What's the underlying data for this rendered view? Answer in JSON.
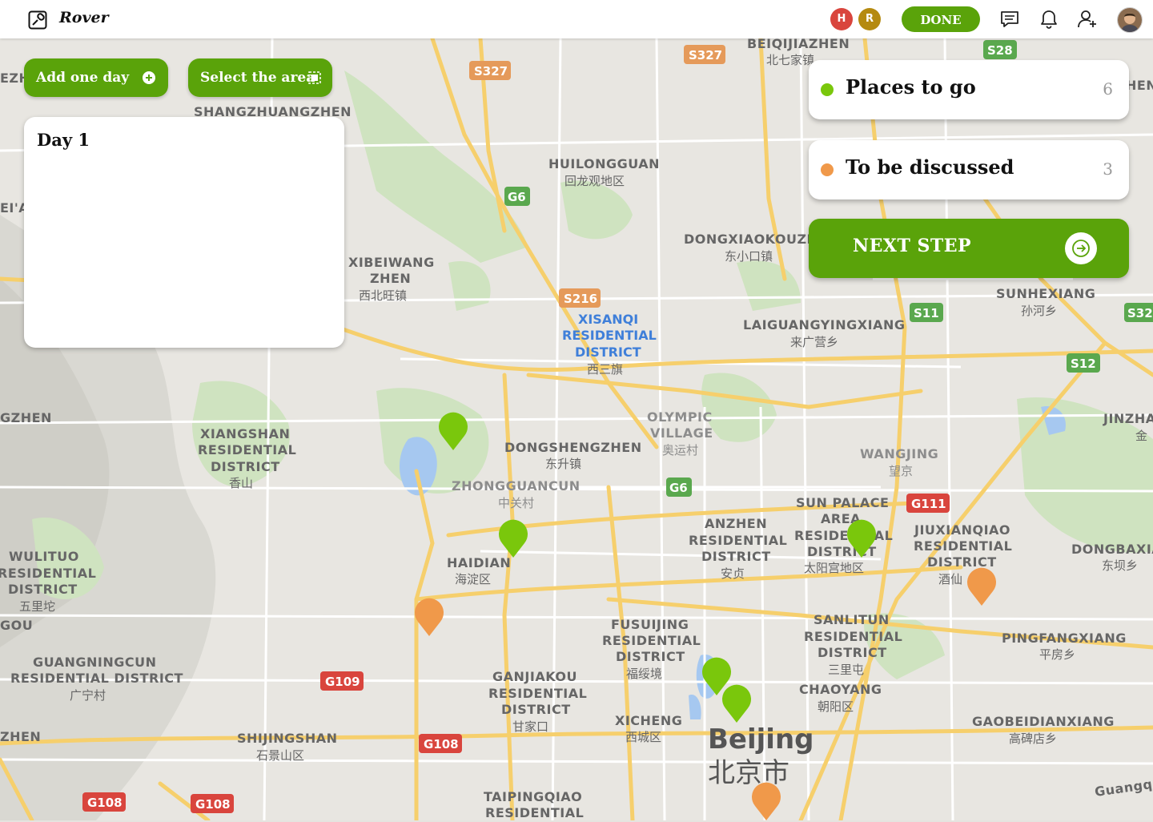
{
  "app": {
    "name": "Rover",
    "done_label": "DONE",
    "collaborators": [
      {
        "initial": "H",
        "color": "#d9453d"
      },
      {
        "initial": "R",
        "color": "#b58a10"
      }
    ],
    "accent": "#5aa30a",
    "icons": [
      "chat-icon",
      "bell-icon",
      "add-user-icon"
    ]
  },
  "controls": {
    "add_day_label": "Add one day",
    "select_area_label": "Select the area"
  },
  "day_panel": {
    "title": "Day 1"
  },
  "categories": [
    {
      "name": "Places to go",
      "count": "6",
      "color": "#7ac70c"
    },
    {
      "name": "To be discussed",
      "count": "3",
      "color": "#f0994a"
    }
  ],
  "next_step_label": "NEXT STEP",
  "map": {
    "city": {
      "name": "Beijing",
      "name_cn": "北京市"
    },
    "places": [
      {
        "en": [
          "BEIQIJIAZHEN"
        ],
        "cn": "北七家镇"
      },
      {
        "en": [
          "SHANGZHUANGZHEN"
        ],
        "cn": ""
      },
      {
        "en": [
          "HUILONGGUAN"
        ],
        "cn": "回龙观地区"
      },
      {
        "en": [
          "DONGXIAOKOUZH"
        ],
        "cn": "东小口镇"
      },
      {
        "en": [
          "XIBEIWANG",
          "ZHEN"
        ],
        "cn": "西北旺镇"
      },
      {
        "en": [
          "LAIGUANGYINGXIANG"
        ],
        "cn": "来广营乡"
      },
      {
        "en": [
          "SUNHEXIANG"
        ],
        "cn": "孙河乡"
      },
      {
        "en": [
          "XIANGSHAN",
          "RESIDENTIAL",
          "DISTRICT"
        ],
        "cn": "香山"
      },
      {
        "en": [
          "DONGSHENGZHEN"
        ],
        "cn": "东升镇"
      },
      {
        "en": [
          "ZHONGGUANCUN"
        ],
        "cn": "中关村"
      },
      {
        "en": [
          "OLYMPIC",
          "VILLAGE"
        ],
        "cn": "奥运村"
      },
      {
        "en": [
          "WANGJING"
        ],
        "cn": "望京"
      },
      {
        "en": [
          "JINZHA"
        ],
        "cn": "金"
      },
      {
        "en": [
          "SUN PALACE",
          "AREA"
        ],
        "cn": ""
      },
      {
        "en": [
          "ANZHEN",
          "RESIDENTIAL",
          "DISTRICT"
        ],
        "cn": "安贞"
      },
      {
        "en": [
          "RESIDENTIAL",
          "DISTRICT"
        ],
        "cn": "太阳宫地区"
      },
      {
        "en": [
          "JIUXIANQIAO",
          "RESIDENTIAL",
          "DISTRICT"
        ],
        "cn": "酒仙"
      },
      {
        "en": [
          "DONGBAXIA"
        ],
        "cn": "东坝乡"
      },
      {
        "en": [
          "HAIDIAN"
        ],
        "cn": "海淀区"
      },
      {
        "en": [
          "WULITUO",
          "RESIDENTIAL",
          "DISTRICT"
        ],
        "cn": "五里坨"
      },
      {
        "en": [
          "FUSUIJING",
          "RESIDENTIAL",
          "DISTRICT"
        ],
        "cn": "福绥境"
      },
      {
        "en": [
          "SANLITUN",
          "RESIDENTIAL",
          "DISTRICT"
        ],
        "cn": "三里屯"
      },
      {
        "en": [
          "PINGFANGXIANG"
        ],
        "cn": "平房乡"
      },
      {
        "en": [
          "GUANGNINGCUN",
          "RESIDENTIAL DISTRICT"
        ],
        "cn": "广宁村"
      },
      {
        "en": [
          "GANJIAKOU",
          "RESIDENTIAL",
          "DISTRICT"
        ],
        "cn": "甘家口"
      },
      {
        "en": [
          "CHAOYANG"
        ],
        "cn": "朝阳区"
      },
      {
        "en": [
          "XICHENG"
        ],
        "cn": "西城区"
      },
      {
        "en": [
          "GAOBEIDIANXIANG"
        ],
        "cn": "高碑店乡"
      },
      {
        "en": [
          "SHIJINGSHAN"
        ],
        "cn": "石景山区"
      },
      {
        "en": [
          "TAIPINGQIAO",
          "RESIDENTIAL"
        ],
        "cn": ""
      },
      {
        "en": [
          "GZHEN"
        ],
        "cn": ""
      },
      {
        "en": [
          "EI'A"
        ],
        "cn": ""
      },
      {
        "en": [
          "EZH"
        ],
        "cn": ""
      },
      {
        "en": [
          "ZHEN"
        ],
        "cn": ""
      },
      {
        "en": [
          "GOU"
        ],
        "cn": ""
      },
      {
        "en": [
          "HEN"
        ],
        "cn": ""
      },
      {
        "en": [
          "Guangq"
        ],
        "cn": ""
      }
    ],
    "district_label": {
      "en": [
        "XISANQI",
        "RESIDENTIAL",
        "DISTRICT"
      ],
      "cn": "西三旗"
    },
    "road_shields": [
      {
        "label": "S327"
      },
      {
        "label": "S327"
      },
      {
        "label": "S28"
      },
      {
        "label": "G6"
      },
      {
        "label": "S216"
      },
      {
        "label": "S11"
      },
      {
        "label": "S12"
      },
      {
        "label": "S32"
      },
      {
        "label": "G6"
      },
      {
        "label": "G111"
      },
      {
        "label": "G109"
      },
      {
        "label": "G108"
      },
      {
        "label": "G108"
      },
      {
        "label": "G108"
      }
    ],
    "pins": [
      {
        "type": "go"
      },
      {
        "type": "go"
      },
      {
        "type": "go"
      },
      {
        "type": "go"
      },
      {
        "type": "go"
      },
      {
        "type": "go"
      },
      {
        "type": "discuss"
      },
      {
        "type": "discuss"
      },
      {
        "type": "discuss"
      }
    ]
  }
}
